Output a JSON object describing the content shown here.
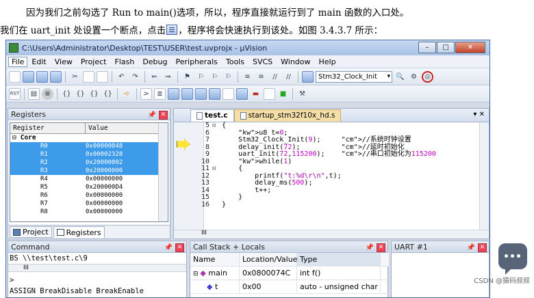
{
  "doc": {
    "line1": "因为我们之前勾选了 Run to main()选项，所以，程序直接就运行到了 main 函数的入口处。",
    "line2_a": "我们在 uart_init 处设置一个断点，点击",
    "line2_b": "，程序将会快速执行到该处。如图 3.4.3.7 所示："
  },
  "window": {
    "title": "C:\\Users\\Administrator\\Desktop\\TEST\\USER\\test.uvprojx - µVision",
    "min_label": "–",
    "max_label": "□",
    "close_label": "✕"
  },
  "menu": [
    "File",
    "Edit",
    "View",
    "Project",
    "Flash",
    "Debug",
    "Peripherals",
    "Tools",
    "SVCS",
    "Window",
    "Help"
  ],
  "toolbar": {
    "target_combo": "Stm32_Clock_Init"
  },
  "registers": {
    "title": "Registers",
    "col_register": "Register",
    "col_value": "Value",
    "group": "Core",
    "rows": [
      {
        "name": "R0",
        "value": "0x00000048",
        "selected": true
      },
      {
        "name": "R1",
        "value": "0x00002328",
        "selected": true
      },
      {
        "name": "R2",
        "value": "0x20000002",
        "selected": true
      },
      {
        "name": "R3",
        "value": "0x20000000",
        "selected": true
      },
      {
        "name": "R4",
        "value": "0x00000000",
        "selected": false
      },
      {
        "name": "R5",
        "value": "0x200000D4",
        "selected": false
      },
      {
        "name": "R6",
        "value": "0x00000000",
        "selected": false
      },
      {
        "name": "R7",
        "value": "0x00000000",
        "selected": false
      },
      {
        "name": "R8",
        "value": "0x00000000",
        "selected": false
      }
    ],
    "tab_project": "Project",
    "tab_registers": "Registers"
  },
  "editor": {
    "tab_active": "test.c",
    "tab_other": "startup_stm32f10x_hd.s",
    "lines": [
      {
        "n": "5",
        "fold": "⊟",
        "code": "{"
      },
      {
        "n": "6",
        "fold": "",
        "code": "    u8 t=0;"
      },
      {
        "n": "7",
        "fold": "",
        "code": "    Stm32_Clock_Init(9);     //系统时钟设置"
      },
      {
        "n": "8",
        "fold": "",
        "code": "    delay_init(72);          //延时初始化"
      },
      {
        "n": "9",
        "fold": "",
        "code": "    uart_init(72,115200);    //串口初始化为115200"
      },
      {
        "n": "10",
        "fold": "",
        "code": "    while(1)"
      },
      {
        "n": "11",
        "fold": "⊟",
        "code": "    {"
      },
      {
        "n": "12",
        "fold": "",
        "code": "        printf(\"t:%d\\r\\n\",t);"
      },
      {
        "n": "13",
        "fold": "",
        "code": "        delay_ms(500);"
      },
      {
        "n": "14",
        "fold": "",
        "code": "        t++;"
      },
      {
        "n": "15",
        "fold": "",
        "code": "    }"
      },
      {
        "n": "16",
        "fold": "",
        "code": "}"
      }
    ],
    "hscroll_thumb": "III"
  },
  "command": {
    "title": "Command",
    "lines": [
      "BS \\\\test\\test.c\\9",
      ">",
      "ASSIGN BreakDisable BreakEnable"
    ],
    "thumb": "III"
  },
  "callstack": {
    "title": "Call Stack + Locals",
    "headers": [
      "Name",
      "Location/Value",
      "Type"
    ],
    "rows": [
      {
        "name": "main",
        "loc": "0x0800074C",
        "type": "int f()"
      },
      {
        "name": "t",
        "loc": "0x00",
        "type": "auto - unsigned char"
      }
    ]
  },
  "uart": {
    "title": "UART #1"
  },
  "watermark": "CSDN @猿码叔叔"
}
